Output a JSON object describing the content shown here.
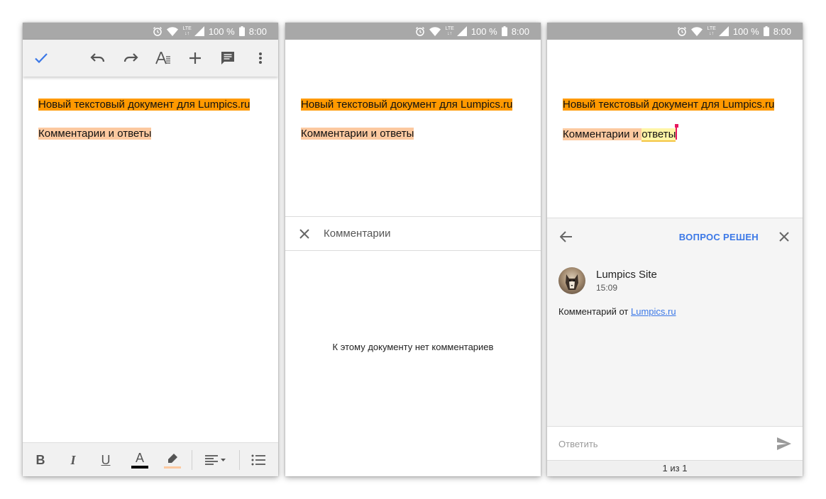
{
  "status": {
    "battery": "100 %",
    "time": "8:00",
    "network": "LTE"
  },
  "document": {
    "line1": "Новый текстовый документ для Lumpics.ru",
    "line2": "Комментарии и ответы",
    "line2_prefix": "Комментарии и ",
    "line2_selected": "ответы"
  },
  "toolbar": {
    "icons": [
      "check-icon",
      "undo-icon",
      "redo-icon",
      "text-format-icon",
      "insert-icon",
      "comment-icon",
      "more-icon"
    ],
    "accent": "#3b78e7"
  },
  "format_bar": {
    "bold": "B",
    "italic": "I",
    "underline": "U",
    "text_color": "A",
    "text_color_value": "#000000",
    "highlight_color_value": "#fcc9a0"
  },
  "comments_panel": {
    "title": "Комментарии",
    "empty_message": "К этому документу нет комментариев"
  },
  "thread": {
    "resolve_label": "ВОПРОС РЕШЕН",
    "author": "Lumpics Site",
    "time": "15:09",
    "comment_prefix": "Комментарий от ",
    "comment_link": "Lumpics.ru",
    "reply_placeholder": "Ответить",
    "pager": "1 из 1"
  },
  "colors": {
    "highlight_orange": "#ff9900",
    "highlight_peach": "#fcc9a0",
    "link_blue": "#3b78e7"
  }
}
